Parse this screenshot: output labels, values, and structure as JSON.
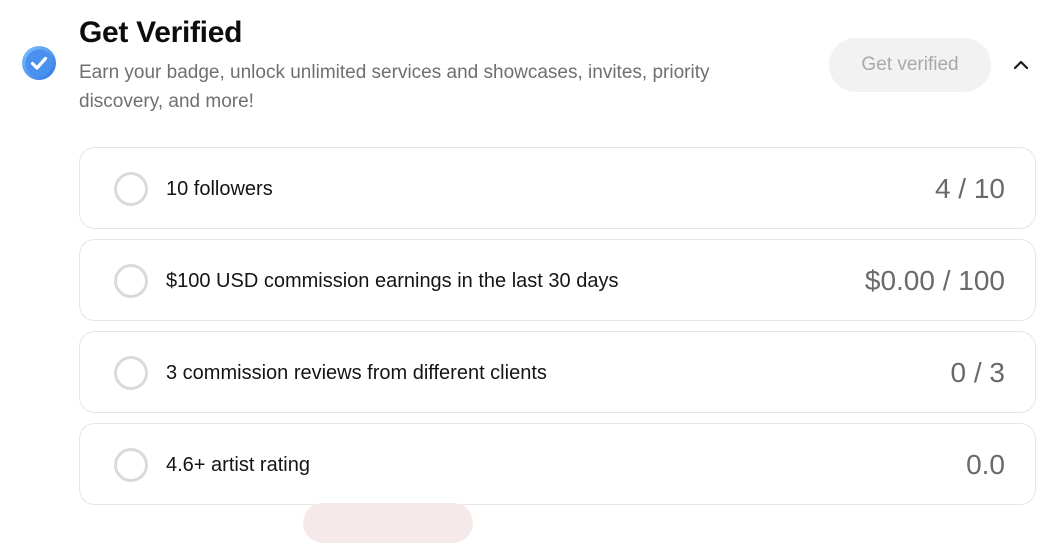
{
  "header": {
    "title": "Get Verified",
    "description": "Earn your badge, unlock unlimited services and showcases, invites, priority discovery, and more!",
    "get_verified_label": "Get verified",
    "badge_icon": "verified-check-badge-icon",
    "collapse_icon": "chevron-up-icon",
    "accent_color": "#3d8ef0"
  },
  "requirements": [
    {
      "label": "10 followers",
      "progress": "4 / 10"
    },
    {
      "label": "$100 USD commission earnings in the last 30 days",
      "progress": "$0.00 / 100"
    },
    {
      "label": "3 commission reviews from different clients",
      "progress": "0 / 3"
    },
    {
      "label": "4.6+ artist rating",
      "progress": "0.0"
    }
  ]
}
